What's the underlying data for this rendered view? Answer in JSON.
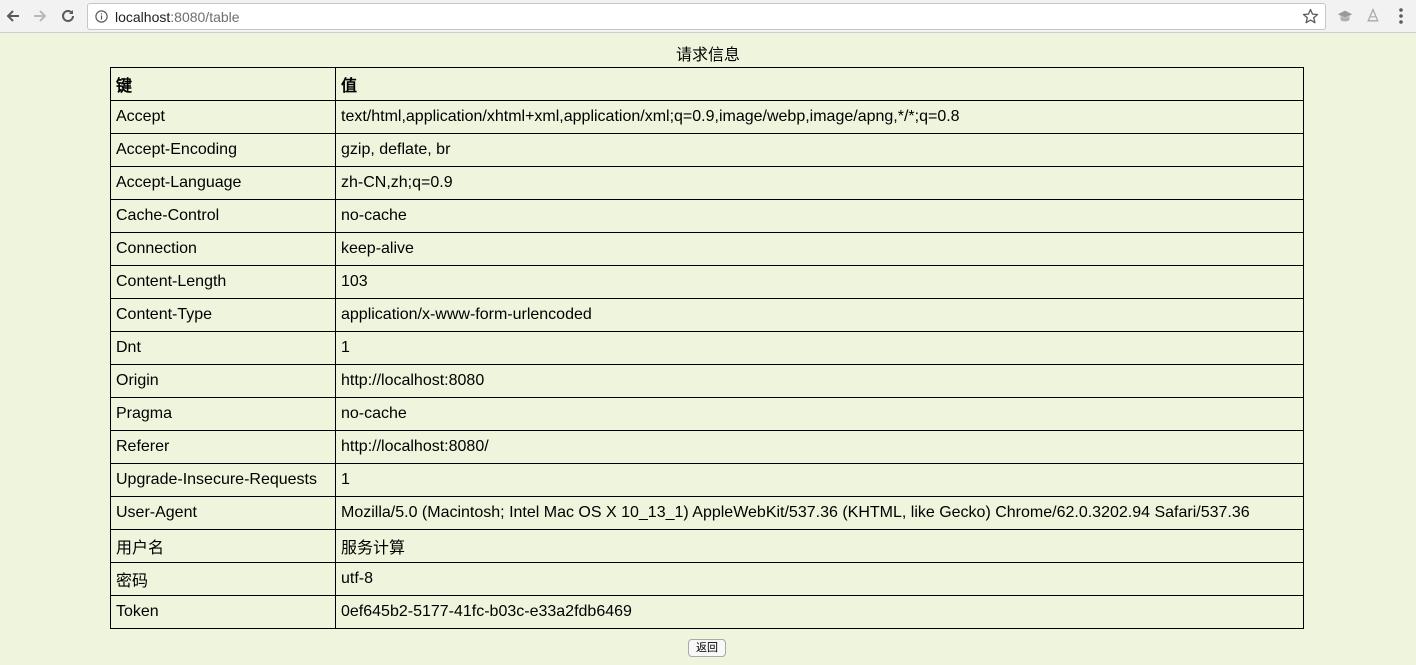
{
  "browser": {
    "url_host": "localhost",
    "url_rest": ":8080/table",
    "icons": {
      "back": "arrow-left-icon",
      "forward": "arrow-right-icon",
      "reload": "reload-icon",
      "info": "info-icon",
      "bookmark": "star-icon",
      "extension1": "extension-icon",
      "extension2": "extension-icon",
      "menu": "kebab-menu-icon"
    }
  },
  "page": {
    "caption": "请求信息",
    "headers": {
      "key": "键",
      "value": "值"
    },
    "rows": [
      {
        "key": "Accept",
        "value": "text/html,application/xhtml+xml,application/xml;q=0.9,image/webp,image/apng,*/*;q=0.8"
      },
      {
        "key": "Accept-Encoding",
        "value": "gzip, deflate, br"
      },
      {
        "key": "Accept-Language",
        "value": "zh-CN,zh;q=0.9"
      },
      {
        "key": "Cache-Control",
        "value": "no-cache"
      },
      {
        "key": "Connection",
        "value": "keep-alive"
      },
      {
        "key": "Content-Length",
        "value": "103"
      },
      {
        "key": "Content-Type",
        "value": "application/x-www-form-urlencoded"
      },
      {
        "key": "Dnt",
        "value": "1"
      },
      {
        "key": "Origin",
        "value": "http://localhost:8080"
      },
      {
        "key": "Pragma",
        "value": "no-cache"
      },
      {
        "key": "Referer",
        "value": "http://localhost:8080/"
      },
      {
        "key": "Upgrade-Insecure-Requests",
        "value": "1"
      },
      {
        "key": "User-Agent",
        "value": "Mozilla/5.0 (Macintosh; Intel Mac OS X 10_13_1) AppleWebKit/537.36 (KHTML, like Gecko) Chrome/62.0.3202.94 Safari/537.36"
      },
      {
        "key": "用户名",
        "value": "服务计算"
      },
      {
        "key": "密码",
        "value": "utf-8"
      },
      {
        "key": "Token",
        "value": "0ef645b2-5177-41fc-b03c-e33a2fdb6469"
      }
    ],
    "back_button": "返回"
  },
  "colors": {
    "page_background": "#eef5dc",
    "border": "#000000"
  }
}
